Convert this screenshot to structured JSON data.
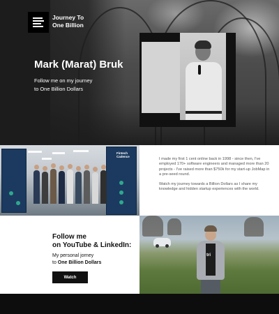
{
  "hero": {
    "logo_line1": "Journey To",
    "logo_line2": "One Billion",
    "title": "Mark (Marat) Bruk",
    "subtitle_line1": "Follow me on my journey",
    "subtitle_line2": "to One Billion Dollars"
  },
  "event_banner": {
    "brand_line1": "Fintech",
    "brand_line2": "Cadence"
  },
  "bio": {
    "paragraph1": "I made my first 1 cent online back in 1998 - since then, I've employed 170+ software engineers and managed more than 20 projects - I've raised more than $750k for my start-up JobMap in a pre-seed round.",
    "paragraph2": "Watch my journey towards a Billion Dollars as I share my knowledge and hidden startup experiences with the world."
  },
  "follow": {
    "title_line1": "Follow me",
    "title_line2": "on YouTube & LinkedIn:",
    "sub_line1": "My personal jorney",
    "sub_prefix": "to ",
    "sub_bold": "One Billion Dollars",
    "button_label": "Watch"
  },
  "field_photo": {
    "shirt_text": "tri"
  }
}
